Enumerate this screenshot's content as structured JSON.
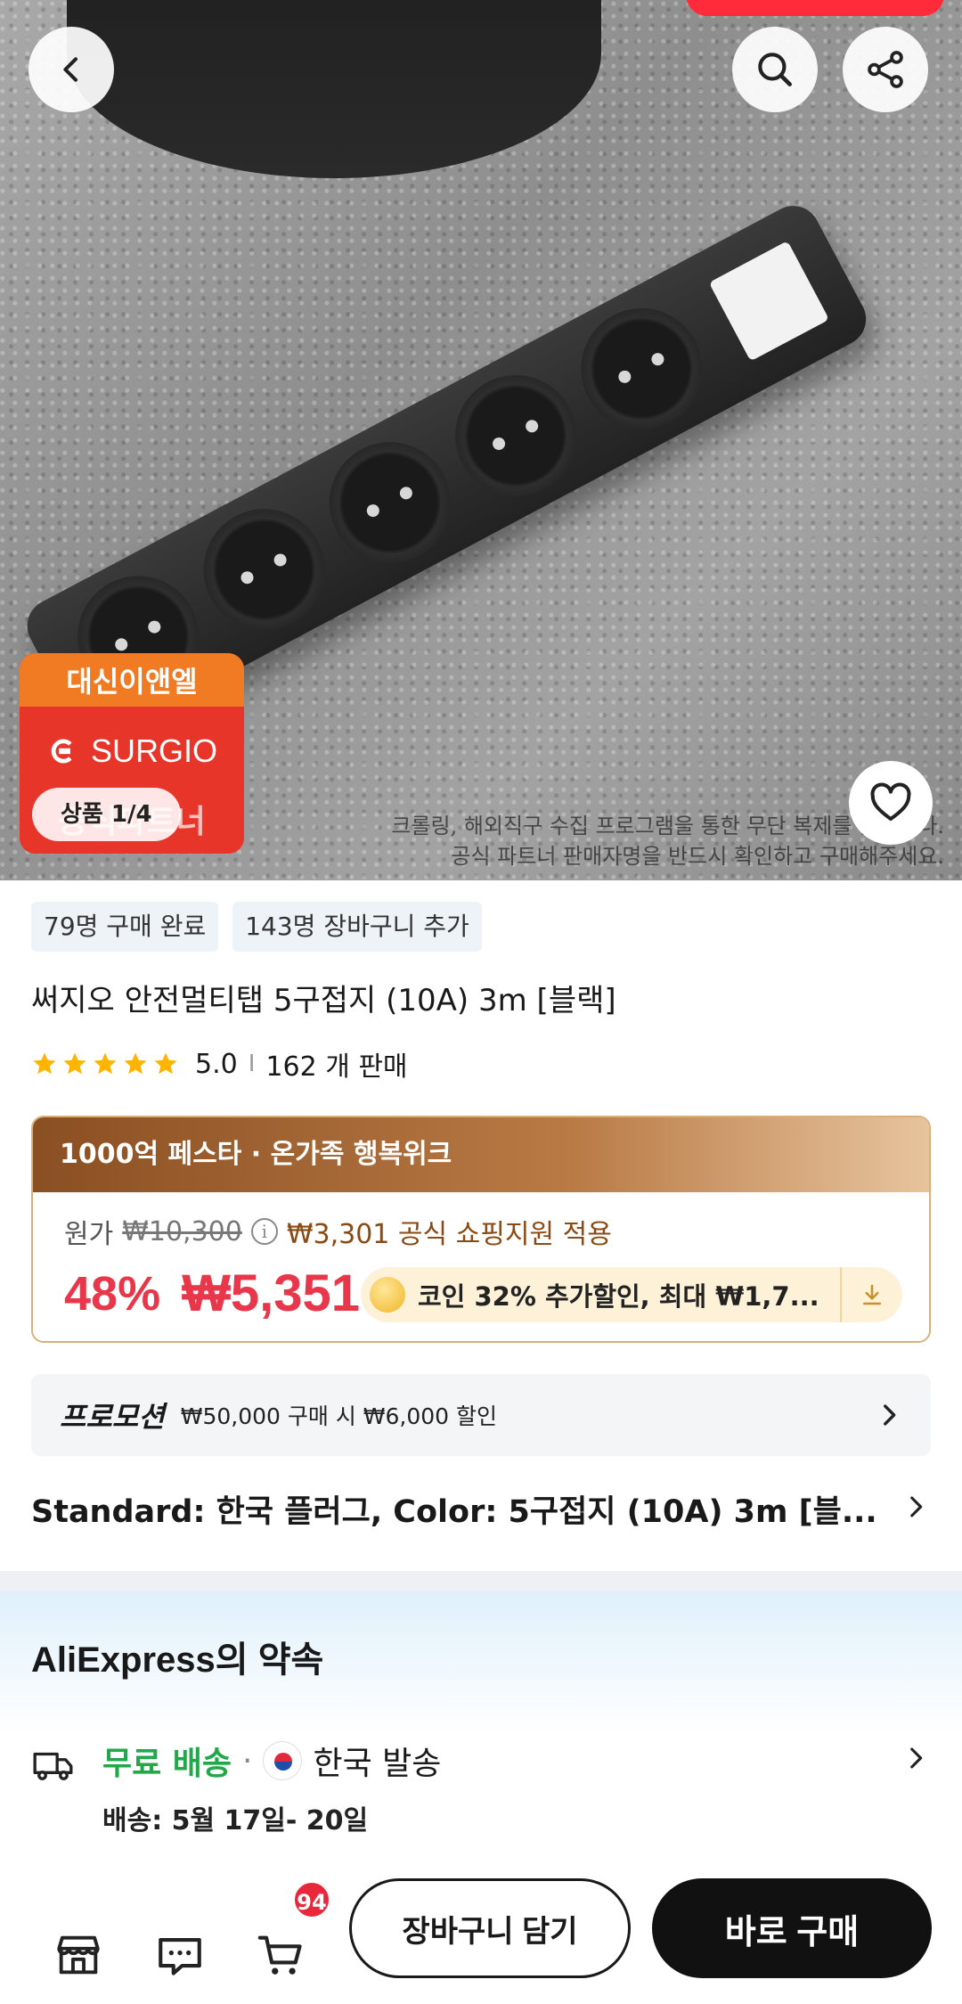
{
  "header": {
    "back_icon": "chevron-left-icon",
    "search_icon": "search-icon",
    "share_icon": "share-icon"
  },
  "gallery": {
    "brand_badge": {
      "top_text": "대신이앤엘",
      "brand_name": "SURGIO",
      "bottom_text": "공식파트너"
    },
    "counter": "상품 1/4",
    "watermark_line1": "크롤링, 해외직구 수집 프로그램을 통한 무단 복제를 금합니다.",
    "watermark_line2": "공식 파트너 판매자명을 반드시 확인하고 구매해주세요."
  },
  "tags": [
    "79명 구매 완료",
    "143명 장바구니 추가"
  ],
  "product": {
    "title": "써지오 안전멀티탭 5구접지 (10A) 3m [블랙]",
    "rating": "5.0",
    "rating_stars": 5,
    "sold": "162 개 판매"
  },
  "promo": {
    "banner": "1000억 페스타 · 온가족 행복위크",
    "orig_label": "원가",
    "orig_price": "₩10,300",
    "support_text": "₩3,301 공식 쇼핑지원 적용",
    "discount": "48%",
    "price": "₩5,351",
    "coin_text": "코인 32% 추가할인, 최대 ₩1,7..."
  },
  "promotion": {
    "label": "프로모션",
    "desc": "₩50,000 구매 시 ₩6,000 할인"
  },
  "variant": "Standard: 한국 플러그, Color: 5구접지 (10A) 3m [블...",
  "promise": {
    "title": "AliExpress의 약속"
  },
  "shipping": {
    "free": "무료 배송",
    "dot": "·",
    "origin": "한국 발송",
    "delivery": "배송: 5월 17일- 20일"
  },
  "bottom_bar": {
    "cart_count": "94",
    "add_to_cart": "장바구니 담기",
    "buy_now": "바로 구매"
  },
  "colors": {
    "accent_red": "#e8374a",
    "free_green": "#21a84a",
    "buy_black": "#111111"
  }
}
